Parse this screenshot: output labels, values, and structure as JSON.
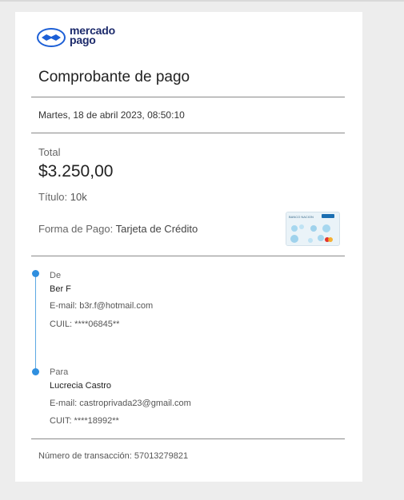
{
  "brand": {
    "logo_line1": "mercado",
    "logo_line2": "pago",
    "accent": "#2f8fdf",
    "navy": "#1c2a6b"
  },
  "receipt": {
    "title": "Comprobante de pago",
    "date": "Martes, 18 de abril 2023, 08:50:10",
    "total_label": "Total",
    "total_amount": "$3.250,00",
    "titulo_label": "Título:",
    "titulo_value": "10k",
    "forma_label": "Forma de Pago:",
    "forma_value": "Tarjeta de Crédito",
    "card_icon": "credit-card-icon",
    "card_bank_text": "BANCO NACION"
  },
  "from": {
    "label": "De",
    "name": "Ber F",
    "email_line": "E-mail: b3r.f@hotmail.com",
    "id_line": "CUIL: ****06845**"
  },
  "to": {
    "label": "Para",
    "name": "Lucrecia Castro",
    "email_line": "E-mail: castroprivada23@gmail.com",
    "id_line": "CUIT: ****18992**"
  },
  "transaction": {
    "line": "Número de transacción: 57013279821"
  }
}
